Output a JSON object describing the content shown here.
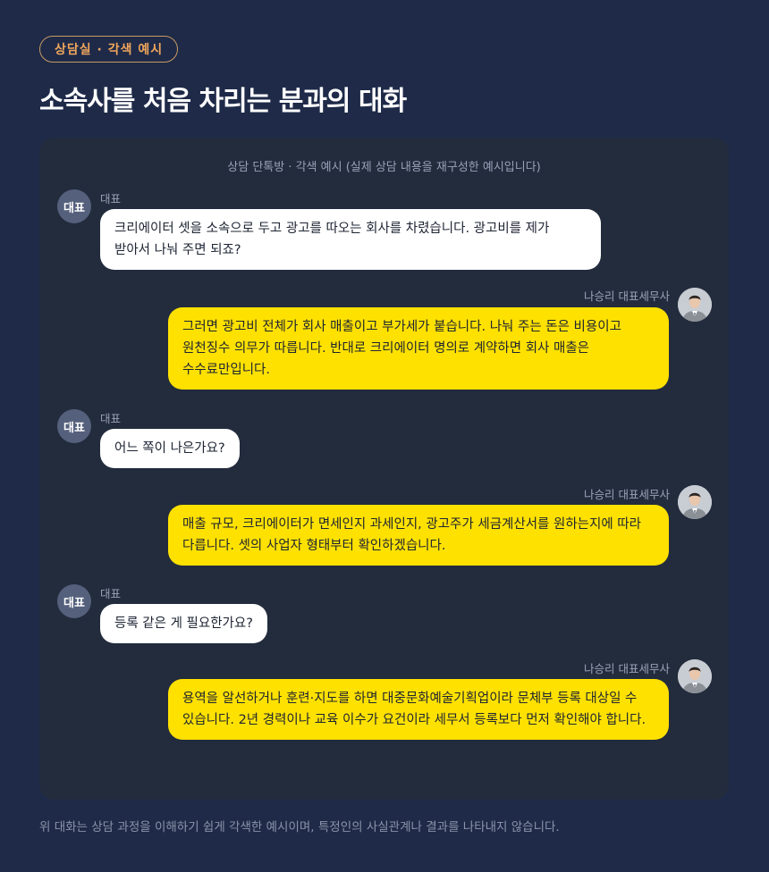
{
  "badge": "상담실 · 각색 예시",
  "title": "소속사를 처음 차리는 분과의 대화",
  "panel_caption": "상담 단톡방 · 각색 예시 (실제 상담 내용을 재구성한 예시입니다)",
  "rep_avatar_label": "대표",
  "messages": [
    {
      "sender": "대표",
      "text": "크리에이터 셋을 소속으로 두고 광고를 따오는 회사를 차렸습니다. 광고비를 제가 받아서 나눠 주면 되죠?"
    },
    {
      "sender": "나승리 대표세무사",
      "text": "그러면 광고비 전체가 회사 매출이고 부가세가 붙습니다. 나눠 주는 돈은 비용이고 원천징수 의무가 따릅니다. 반대로 크리에이터 명의로 계약하면 회사 매출은 수수료만입니다."
    },
    {
      "sender": "대표",
      "text": "어느 쪽이 나은가요?"
    },
    {
      "sender": "나승리 대표세무사",
      "text": "매출 규모, 크리에이터가 면세인지 과세인지, 광고주가 세금계산서를 원하는지에 따라 다릅니다. 셋의 사업자 형태부터 확인하겠습니다."
    },
    {
      "sender": "대표",
      "text": "등록 같은 게 필요한가요?"
    },
    {
      "sender": "나승리 대표세무사",
      "text": "용역을 알선하거나 훈련·지도를 하면 대중문화예술기획업이라 문체부 등록 대상일 수 있습니다. 2년 경력이나 교육 이수가 요건이라 세무서 등록보다 먼저 확인해야 합니다."
    }
  ],
  "footnote": "위 대화는 상담 과정을 이해하기 쉽게 각색한 예시이며, 특정인의 사실관계나 결과를 나타내지 않습니다.",
  "colors": {
    "background": "#1e2a48",
    "panel": "#232c3d",
    "rep_bubble": "#ffffff",
    "tax_bubble": "#ffe100",
    "badge_accent": "#f0a65c"
  }
}
